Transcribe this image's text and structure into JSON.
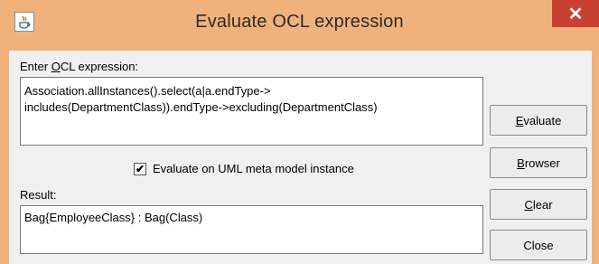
{
  "window": {
    "title": "Evaluate OCL expression",
    "app_icon": "java-app-icon",
    "close_icon_glyph": "✕",
    "titlebar_color": "#f0b27a",
    "close_color": "#c84031"
  },
  "expression": {
    "label_prefix": "Enter ",
    "label_mnemonic": "O",
    "label_suffix": "CL expression:",
    "value": "Association.allInstances().select(a|a.endType->\nincludes(DepartmentClass)).endType->excluding(DepartmentClass)"
  },
  "options": {
    "meta_model_checkbox_label": "Evaluate on UML meta model instance",
    "meta_model_checkbox_checked": true,
    "check_glyph": "✔"
  },
  "result": {
    "label": "Result:",
    "value": "Bag{EmployeeClass} : Bag(Class)"
  },
  "buttons": {
    "evaluate": {
      "mnemonic": "E",
      "rest": "valuate"
    },
    "browser": {
      "mnemonic": "B",
      "rest": "rowser"
    },
    "clear": {
      "mnemonic": "C",
      "rest": "lear"
    },
    "close": {
      "label": "Close"
    }
  }
}
